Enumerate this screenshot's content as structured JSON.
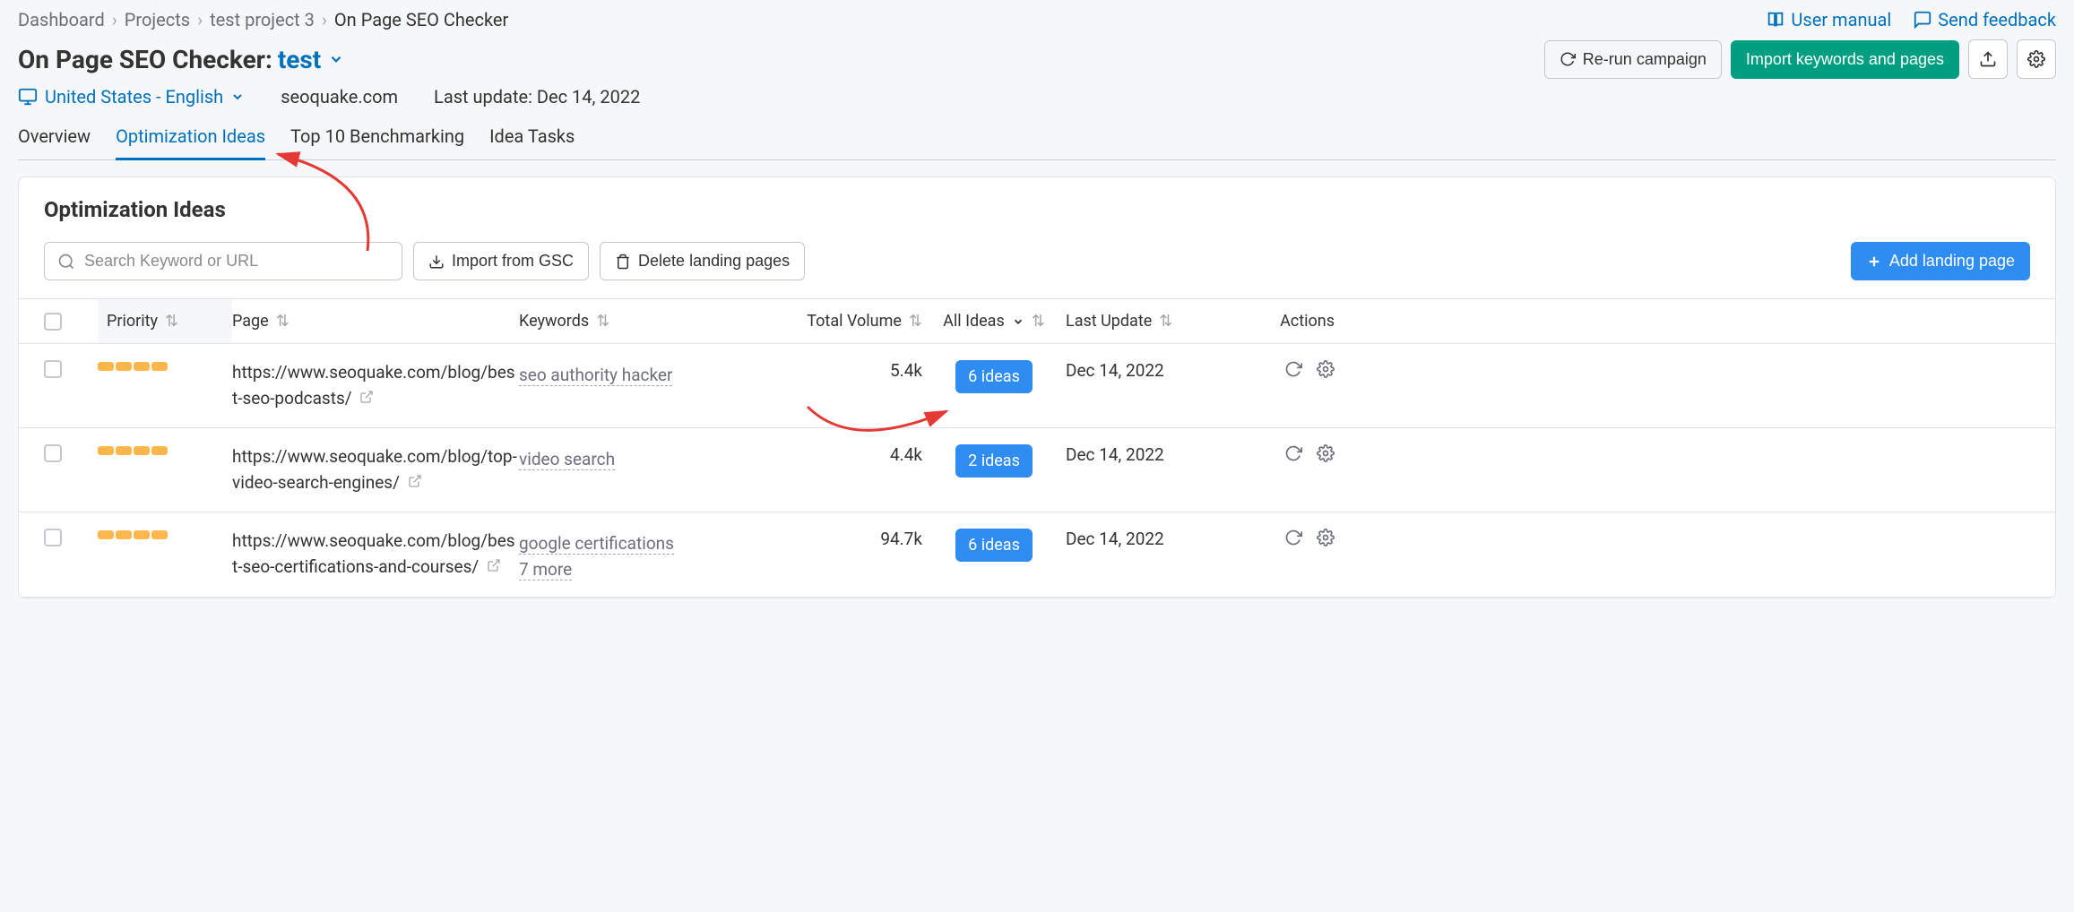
{
  "breadcrumb": {
    "items": [
      "Dashboard",
      "Projects",
      "test project 3",
      "On Page SEO Checker"
    ]
  },
  "top_links": {
    "manual": "User manual",
    "feedback": "Send feedback"
  },
  "title": {
    "label": "On Page SEO Checker:",
    "project": "test"
  },
  "buttons": {
    "rerun": "Re-run campaign",
    "import_kw": "Import keywords and pages",
    "import_gsc": "Import from GSC",
    "delete_lp": "Delete landing pages",
    "add_lp": "Add landing page"
  },
  "sub": {
    "locale": "United States - English",
    "domain": "seoquake.com",
    "last_update": "Last update: Dec 14, 2022"
  },
  "tabs": {
    "items": [
      "Overview",
      "Optimization Ideas",
      "Top 10 Benchmarking",
      "Idea Tasks"
    ],
    "active": 1
  },
  "card": {
    "title": "Optimization Ideas",
    "search_placeholder": "Search Keyword or URL"
  },
  "columns": {
    "priority": "Priority",
    "page": "Page",
    "keywords": "Keywords",
    "volume": "Total Volume",
    "ideas": "All Ideas",
    "last_update": "Last Update",
    "actions": "Actions"
  },
  "rows": [
    {
      "url": "https://www.seoquake.com/blog/best-seo-podcasts/",
      "keyword": "seo authority hacker",
      "more": "",
      "volume": "5.4k",
      "ideas": "6 ideas",
      "last_update": "Dec 14, 2022"
    },
    {
      "url": "https://www.seoquake.com/blog/top-video-search-engines/",
      "keyword": "video search",
      "more": "",
      "volume": "4.4k",
      "ideas": "2 ideas",
      "last_update": "Dec 14, 2022"
    },
    {
      "url": "https://www.seoquake.com/blog/best-seo-certifications-and-courses/",
      "keyword": "google certifications",
      "more": "7 more",
      "volume": "94.7k",
      "ideas": "6 ideas",
      "last_update": "Dec 14, 2022"
    }
  ]
}
